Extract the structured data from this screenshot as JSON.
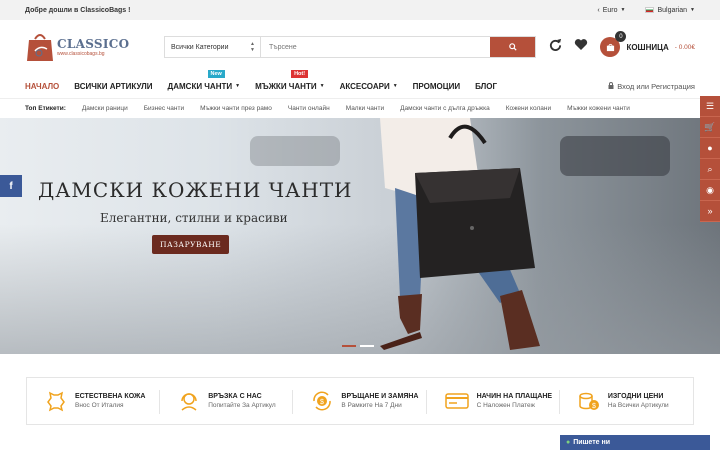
{
  "topbar": {
    "welcome": "Добре дошли в ClassicoBags !",
    "currency": "Euro",
    "language": "Bulgarian"
  },
  "header": {
    "logo_brand": "CLASSICO",
    "logo_url": "www.classicobags.bg",
    "search_category": "Всички Категории",
    "search_placeholder": "Търсене",
    "cart_count": "0",
    "cart_label": "КОШНИЦА",
    "cart_total": "- 0.00€"
  },
  "nav": {
    "items": [
      {
        "label": "НАЧАЛО"
      },
      {
        "label": "ВСИЧКИ АРТИКУЛИ"
      },
      {
        "label": "ДАМСКИ ЧАНТИ",
        "badge": "New"
      },
      {
        "label": "МЪЖКИ ЧАНТИ",
        "badge": "Hot!"
      },
      {
        "label": "АКСЕСОАРИ"
      },
      {
        "label": "ПРОМОЦИИ"
      },
      {
        "label": "БЛОГ"
      }
    ],
    "login": "Вход или Регистрация"
  },
  "tags": {
    "label": "Топ Етикети:",
    "items": [
      "Дамски раници",
      "Бизнес чанти",
      "Мъжки чанти през рамо",
      "Чанти онлайн",
      "Малки чанти",
      "Дамски чанти с дълга дръжка",
      "Кожени колани",
      "Мъжки кожени чанти"
    ]
  },
  "hero": {
    "title": "ДАМСКИ КОЖЕНИ ЧАНТИ",
    "subtitle": "Елегантни, стилни и красиви",
    "button": "ПАЗАРУВАНЕ"
  },
  "features": [
    {
      "title": "ЕСТЕСТВЕНА КОЖА",
      "sub": "Внос От Италия"
    },
    {
      "title": "ВРЪЗКА С НАС",
      "sub": "Попитайте За Артикул"
    },
    {
      "title": "ВРЪЩАНЕ И ЗАМЯНА",
      "sub": "В Рамките На 7 Дни"
    },
    {
      "title": "НАЧИН НА ПЛАЩАНЕ",
      "sub": "С Наложен Платеж"
    },
    {
      "title": "ИЗГОДНИ ЦЕНИ",
      "sub": "На Всички Артикули"
    }
  ],
  "chat": {
    "label": "Пишете ни"
  },
  "colors": {
    "accent": "#b5503a",
    "facebook": "#3b5998"
  }
}
